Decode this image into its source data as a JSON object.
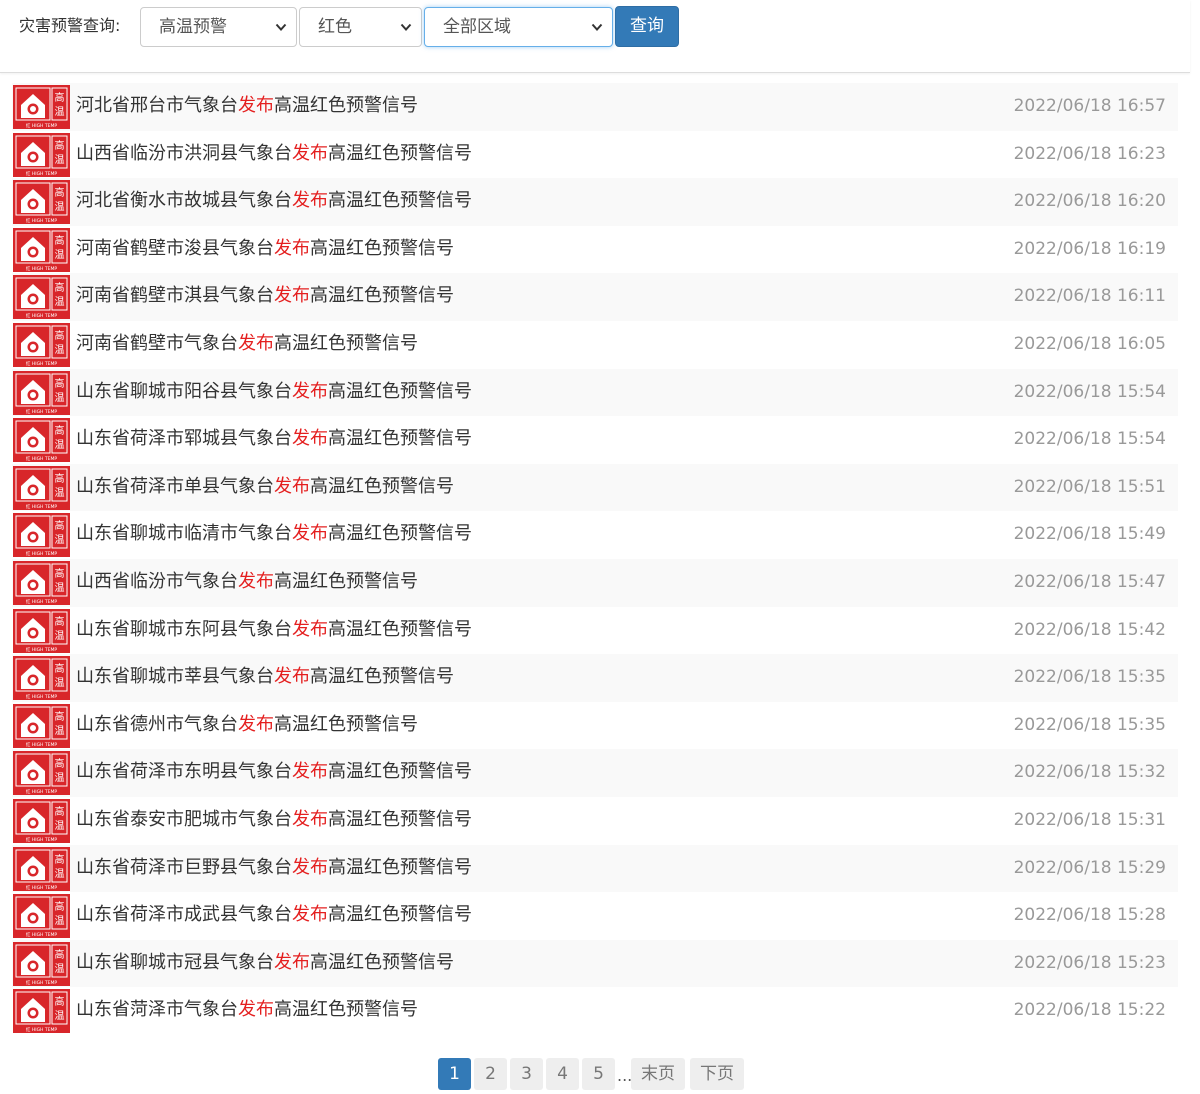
{
  "toolbar": {
    "label": "灾害预警查询:",
    "type_select": "高温预警",
    "color_select": "红色",
    "region_select": "全部区域",
    "query_button": "查询"
  },
  "colors": {
    "accent": "#337ab7",
    "highlight": "#e41f1f",
    "badge_red": "#d8262a"
  },
  "badge": {
    "icon": "high-temperature-warning-icon",
    "char1": "高",
    "char2": "温",
    "footer": "红 HIGH TEMP"
  },
  "list": [
    {
      "before": "河北省邢台市气象台",
      "verb": "发布",
      "after": "高温红色预警信号",
      "time": "2022/06/18 16:57"
    },
    {
      "before": "山西省临汾市洪洞县气象台",
      "verb": "发布",
      "after": "高温红色预警信号",
      "time": "2022/06/18 16:23"
    },
    {
      "before": "河北省衡水市故城县气象台",
      "verb": "发布",
      "after": "高温红色预警信号",
      "time": "2022/06/18 16:20"
    },
    {
      "before": "河南省鹤壁市浚县气象台",
      "verb": "发布",
      "after": "高温红色预警信号",
      "time": "2022/06/18 16:19"
    },
    {
      "before": "河南省鹤壁市淇县气象台",
      "verb": "发布",
      "after": "高温红色预警信号",
      "time": "2022/06/18 16:11"
    },
    {
      "before": "河南省鹤壁市气象台",
      "verb": "发布",
      "after": "高温红色预警信号",
      "time": "2022/06/18 16:05"
    },
    {
      "before": "山东省聊城市阳谷县气象台",
      "verb": "发布",
      "after": "高温红色预警信号",
      "time": "2022/06/18 15:54"
    },
    {
      "before": "山东省荷泽市郓城县气象台",
      "verb": "发布",
      "after": "高温红色预警信号",
      "time": "2022/06/18 15:54"
    },
    {
      "before": "山东省荷泽市单县气象台",
      "verb": "发布",
      "after": "高温红色预警信号",
      "time": "2022/06/18 15:51"
    },
    {
      "before": "山东省聊城市临清市气象台",
      "verb": "发布",
      "after": "高温红色预警信号",
      "time": "2022/06/18 15:49"
    },
    {
      "before": "山西省临汾市气象台",
      "verb": "发布",
      "after": "高温红色预警信号",
      "time": "2022/06/18 15:47"
    },
    {
      "before": "山东省聊城市东阿县气象台",
      "verb": "发布",
      "after": "高温红色预警信号",
      "time": "2022/06/18 15:42"
    },
    {
      "before": "山东省聊城市莘县气象台",
      "verb": "发布",
      "after": "高温红色预警信号",
      "time": "2022/06/18 15:35"
    },
    {
      "before": "山东省德州市气象台",
      "verb": "发布",
      "after": "高温红色预警信号",
      "time": "2022/06/18 15:35"
    },
    {
      "before": "山东省荷泽市东明县气象台",
      "verb": "发布",
      "after": "高温红色预警信号",
      "time": "2022/06/18 15:32"
    },
    {
      "before": "山东省泰安市肥城市气象台",
      "verb": "发布",
      "after": "高温红色预警信号",
      "time": "2022/06/18 15:31"
    },
    {
      "before": "山东省荷泽市巨野县气象台",
      "verb": "发布",
      "after": "高温红色预警信号",
      "time": "2022/06/18 15:29"
    },
    {
      "before": "山东省荷泽市成武县气象台",
      "verb": "发布",
      "after": "高温红色预警信号",
      "time": "2022/06/18 15:28"
    },
    {
      "before": "山东省聊城市冠县气象台",
      "verb": "发布",
      "after": "高温红色预警信号",
      "time": "2022/06/18 15:23"
    },
    {
      "before": "山东省菏泽市气象台",
      "verb": "发布",
      "after": "高温红色预警信号",
      "time": "2022/06/18 15:22"
    }
  ],
  "pagination": {
    "pages": [
      "1",
      "2",
      "3",
      "4",
      "5"
    ],
    "current": "1",
    "ellipsis": "...",
    "last": "末页",
    "next": "下页"
  }
}
